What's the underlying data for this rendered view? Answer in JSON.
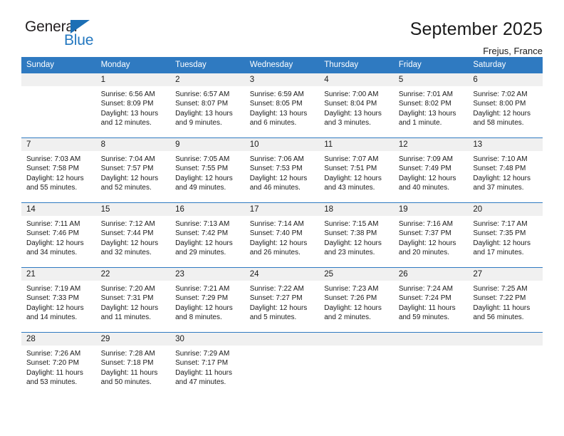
{
  "brand": {
    "name_part1": "General",
    "name_part2": "Blue",
    "triangle_color": "#1c6fb5",
    "blue_color": "#2478c0"
  },
  "header": {
    "title": "September 2025",
    "subtitle": "Frejus, France"
  },
  "theme": {
    "header_bg": "#2f7ac1",
    "daynum_bg": "#f0f0f0",
    "text": "#1a1a1a"
  },
  "weekdays": [
    "Sunday",
    "Monday",
    "Tuesday",
    "Wednesday",
    "Thursday",
    "Friday",
    "Saturday"
  ],
  "weeks": [
    [
      {
        "day": "",
        "lines": []
      },
      {
        "day": "1",
        "lines": [
          "Sunrise: 6:56 AM",
          "Sunset: 8:09 PM",
          "Daylight: 13 hours",
          "and 12 minutes."
        ]
      },
      {
        "day": "2",
        "lines": [
          "Sunrise: 6:57 AM",
          "Sunset: 8:07 PM",
          "Daylight: 13 hours",
          "and 9 minutes."
        ]
      },
      {
        "day": "3",
        "lines": [
          "Sunrise: 6:59 AM",
          "Sunset: 8:05 PM",
          "Daylight: 13 hours",
          "and 6 minutes."
        ]
      },
      {
        "day": "4",
        "lines": [
          "Sunrise: 7:00 AM",
          "Sunset: 8:04 PM",
          "Daylight: 13 hours",
          "and 3 minutes."
        ]
      },
      {
        "day": "5",
        "lines": [
          "Sunrise: 7:01 AM",
          "Sunset: 8:02 PM",
          "Daylight: 13 hours",
          "and 1 minute."
        ]
      },
      {
        "day": "6",
        "lines": [
          "Sunrise: 7:02 AM",
          "Sunset: 8:00 PM",
          "Daylight: 12 hours",
          "and 58 minutes."
        ]
      }
    ],
    [
      {
        "day": "7",
        "lines": [
          "Sunrise: 7:03 AM",
          "Sunset: 7:58 PM",
          "Daylight: 12 hours",
          "and 55 minutes."
        ]
      },
      {
        "day": "8",
        "lines": [
          "Sunrise: 7:04 AM",
          "Sunset: 7:57 PM",
          "Daylight: 12 hours",
          "and 52 minutes."
        ]
      },
      {
        "day": "9",
        "lines": [
          "Sunrise: 7:05 AM",
          "Sunset: 7:55 PM",
          "Daylight: 12 hours",
          "and 49 minutes."
        ]
      },
      {
        "day": "10",
        "lines": [
          "Sunrise: 7:06 AM",
          "Sunset: 7:53 PM",
          "Daylight: 12 hours",
          "and 46 minutes."
        ]
      },
      {
        "day": "11",
        "lines": [
          "Sunrise: 7:07 AM",
          "Sunset: 7:51 PM",
          "Daylight: 12 hours",
          "and 43 minutes."
        ]
      },
      {
        "day": "12",
        "lines": [
          "Sunrise: 7:09 AM",
          "Sunset: 7:49 PM",
          "Daylight: 12 hours",
          "and 40 minutes."
        ]
      },
      {
        "day": "13",
        "lines": [
          "Sunrise: 7:10 AM",
          "Sunset: 7:48 PM",
          "Daylight: 12 hours",
          "and 37 minutes."
        ]
      }
    ],
    [
      {
        "day": "14",
        "lines": [
          "Sunrise: 7:11 AM",
          "Sunset: 7:46 PM",
          "Daylight: 12 hours",
          "and 34 minutes."
        ]
      },
      {
        "day": "15",
        "lines": [
          "Sunrise: 7:12 AM",
          "Sunset: 7:44 PM",
          "Daylight: 12 hours",
          "and 32 minutes."
        ]
      },
      {
        "day": "16",
        "lines": [
          "Sunrise: 7:13 AM",
          "Sunset: 7:42 PM",
          "Daylight: 12 hours",
          "and 29 minutes."
        ]
      },
      {
        "day": "17",
        "lines": [
          "Sunrise: 7:14 AM",
          "Sunset: 7:40 PM",
          "Daylight: 12 hours",
          "and 26 minutes."
        ]
      },
      {
        "day": "18",
        "lines": [
          "Sunrise: 7:15 AM",
          "Sunset: 7:38 PM",
          "Daylight: 12 hours",
          "and 23 minutes."
        ]
      },
      {
        "day": "19",
        "lines": [
          "Sunrise: 7:16 AM",
          "Sunset: 7:37 PM",
          "Daylight: 12 hours",
          "and 20 minutes."
        ]
      },
      {
        "day": "20",
        "lines": [
          "Sunrise: 7:17 AM",
          "Sunset: 7:35 PM",
          "Daylight: 12 hours",
          "and 17 minutes."
        ]
      }
    ],
    [
      {
        "day": "21",
        "lines": [
          "Sunrise: 7:19 AM",
          "Sunset: 7:33 PM",
          "Daylight: 12 hours",
          "and 14 minutes."
        ]
      },
      {
        "day": "22",
        "lines": [
          "Sunrise: 7:20 AM",
          "Sunset: 7:31 PM",
          "Daylight: 12 hours",
          "and 11 minutes."
        ]
      },
      {
        "day": "23",
        "lines": [
          "Sunrise: 7:21 AM",
          "Sunset: 7:29 PM",
          "Daylight: 12 hours",
          "and 8 minutes."
        ]
      },
      {
        "day": "24",
        "lines": [
          "Sunrise: 7:22 AM",
          "Sunset: 7:27 PM",
          "Daylight: 12 hours",
          "and 5 minutes."
        ]
      },
      {
        "day": "25",
        "lines": [
          "Sunrise: 7:23 AM",
          "Sunset: 7:26 PM",
          "Daylight: 12 hours",
          "and 2 minutes."
        ]
      },
      {
        "day": "26",
        "lines": [
          "Sunrise: 7:24 AM",
          "Sunset: 7:24 PM",
          "Daylight: 11 hours",
          "and 59 minutes."
        ]
      },
      {
        "day": "27",
        "lines": [
          "Sunrise: 7:25 AM",
          "Sunset: 7:22 PM",
          "Daylight: 11 hours",
          "and 56 minutes."
        ]
      }
    ],
    [
      {
        "day": "28",
        "lines": [
          "Sunrise: 7:26 AM",
          "Sunset: 7:20 PM",
          "Daylight: 11 hours",
          "and 53 minutes."
        ]
      },
      {
        "day": "29",
        "lines": [
          "Sunrise: 7:28 AM",
          "Sunset: 7:18 PM",
          "Daylight: 11 hours",
          "and 50 minutes."
        ]
      },
      {
        "day": "30",
        "lines": [
          "Sunrise: 7:29 AM",
          "Sunset: 7:17 PM",
          "Daylight: 11 hours",
          "and 47 minutes."
        ]
      },
      {
        "day": "",
        "lines": []
      },
      {
        "day": "",
        "lines": []
      },
      {
        "day": "",
        "lines": []
      },
      {
        "day": "",
        "lines": []
      }
    ]
  ]
}
